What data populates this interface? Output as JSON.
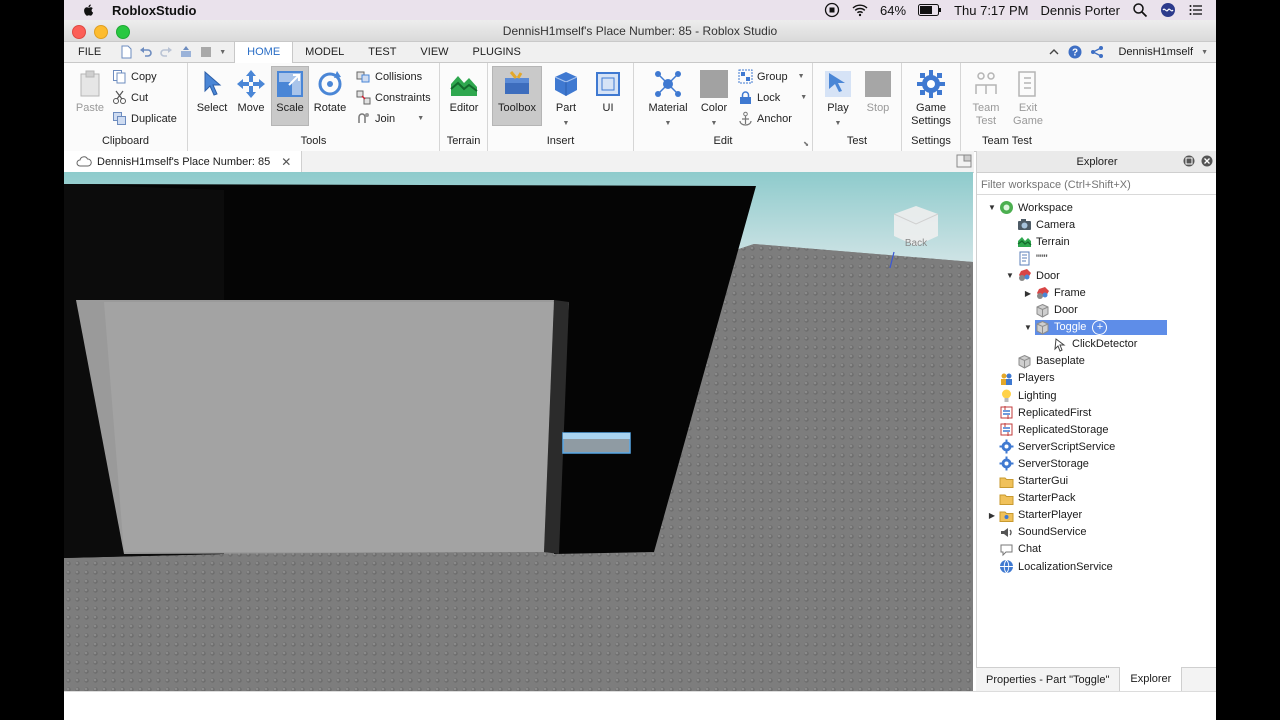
{
  "menubar": {
    "app_name": "RobloxStudio",
    "battery": "64%",
    "clock": "Thu 7:17 PM",
    "user": "Dennis Porter"
  },
  "window": {
    "title": "DennisH1mself's Place Number: 85 - Roblox Studio"
  },
  "ribbon_tabs": {
    "file": "FILE",
    "home": "HOME",
    "model": "MODEL",
    "test": "TEST",
    "view": "VIEW",
    "plugins": "PLUGINS",
    "username": "DennisH1mself"
  },
  "ribbon": {
    "clipboard": {
      "paste": "Paste",
      "copy": "Copy",
      "cut": "Cut",
      "duplicate": "Duplicate",
      "label": "Clipboard"
    },
    "tools": {
      "select": "Select",
      "move": "Move",
      "scale": "Scale",
      "rotate": "Rotate",
      "collisions": "Collisions",
      "constraints": "Constraints",
      "join": "Join",
      "label": "Tools"
    },
    "terrain": {
      "editor": "Editor",
      "label": "Terrain"
    },
    "insert": {
      "toolbox": "Toolbox",
      "part": "Part",
      "ui": "UI",
      "label": "Insert"
    },
    "edit": {
      "material": "Material",
      "color": "Color",
      "group": "Group",
      "lock": "Lock",
      "anchor": "Anchor",
      "label": "Edit"
    },
    "test": {
      "play": "Play",
      "stop": "Stop",
      "label": "Test"
    },
    "settings": {
      "game_settings_1": "Game",
      "game_settings_2": "Settings",
      "label": "Settings"
    },
    "team_test": {
      "team_test_1": "Team",
      "team_test_2": "Test",
      "exit_game_1": "Exit",
      "exit_game_2": "Game",
      "label": "Team Test"
    }
  },
  "doc_tab": {
    "title": "DennisH1mself's Place Number: 85"
  },
  "viewport": {
    "view_cube_label": "Back"
  },
  "explorer": {
    "title": "Explorer",
    "filter_placeholder": "Filter workspace (Ctrl+Shift+X)",
    "tree": [
      {
        "label": "Workspace",
        "depth": 0,
        "expander": "open",
        "icon": "workspace-icon"
      },
      {
        "label": "Camera",
        "depth": 1,
        "expander": "none",
        "icon": "camera-icon"
      },
      {
        "label": "Terrain",
        "depth": 1,
        "expander": "none",
        "icon": "terrain-icon"
      },
      {
        "label": "\"\"\"",
        "depth": 1,
        "expander": "none",
        "icon": "script-icon"
      },
      {
        "label": "Door",
        "depth": 1,
        "expander": "open",
        "icon": "model-icon"
      },
      {
        "label": "Frame",
        "depth": 2,
        "expander": "closed",
        "icon": "model-icon"
      },
      {
        "label": "Door",
        "depth": 2,
        "expander": "none",
        "icon": "part-icon"
      },
      {
        "label": "Toggle",
        "depth": 2,
        "expander": "open",
        "icon": "part-icon",
        "selected": true
      },
      {
        "label": "ClickDetector",
        "depth": 3,
        "expander": "none",
        "icon": "clickdetector-icon"
      },
      {
        "label": "Baseplate",
        "depth": 1,
        "expander": "none",
        "icon": "part-icon"
      },
      {
        "label": "Players",
        "depth": 0,
        "expander": "none",
        "icon": "players-icon"
      },
      {
        "label": "Lighting",
        "depth": 0,
        "expander": "none",
        "icon": "lighting-icon"
      },
      {
        "label": "ReplicatedFirst",
        "depth": 0,
        "expander": "none",
        "icon": "replicated-icon"
      },
      {
        "label": "ReplicatedStorage",
        "depth": 0,
        "expander": "none",
        "icon": "replicated-icon"
      },
      {
        "label": "ServerScriptService",
        "depth": 0,
        "expander": "none",
        "icon": "service-gear-icon"
      },
      {
        "label": "ServerStorage",
        "depth": 0,
        "expander": "none",
        "icon": "service-gear-icon"
      },
      {
        "label": "StarterGui",
        "depth": 0,
        "expander": "none",
        "icon": "folder-icon"
      },
      {
        "label": "StarterPack",
        "depth": 0,
        "expander": "none",
        "icon": "folder-icon"
      },
      {
        "label": "StarterPlayer",
        "depth": 0,
        "expander": "closed",
        "icon": "starterplayer-icon"
      },
      {
        "label": "SoundService",
        "depth": 0,
        "expander": "none",
        "icon": "sound-icon"
      },
      {
        "label": "Chat",
        "depth": 0,
        "expander": "none",
        "icon": "chat-icon"
      },
      {
        "label": "LocalizationService",
        "depth": 0,
        "expander": "none",
        "icon": "globe-icon"
      }
    ]
  },
  "bottom_tabs": {
    "properties": "Properties - Part \"Toggle\"",
    "explorer": "Explorer"
  },
  "colors": {
    "accent": "#2a6ec6",
    "selection": "#5e8de8",
    "sky": "#8fc9cc",
    "baseplate": "#7b7b7b"
  }
}
